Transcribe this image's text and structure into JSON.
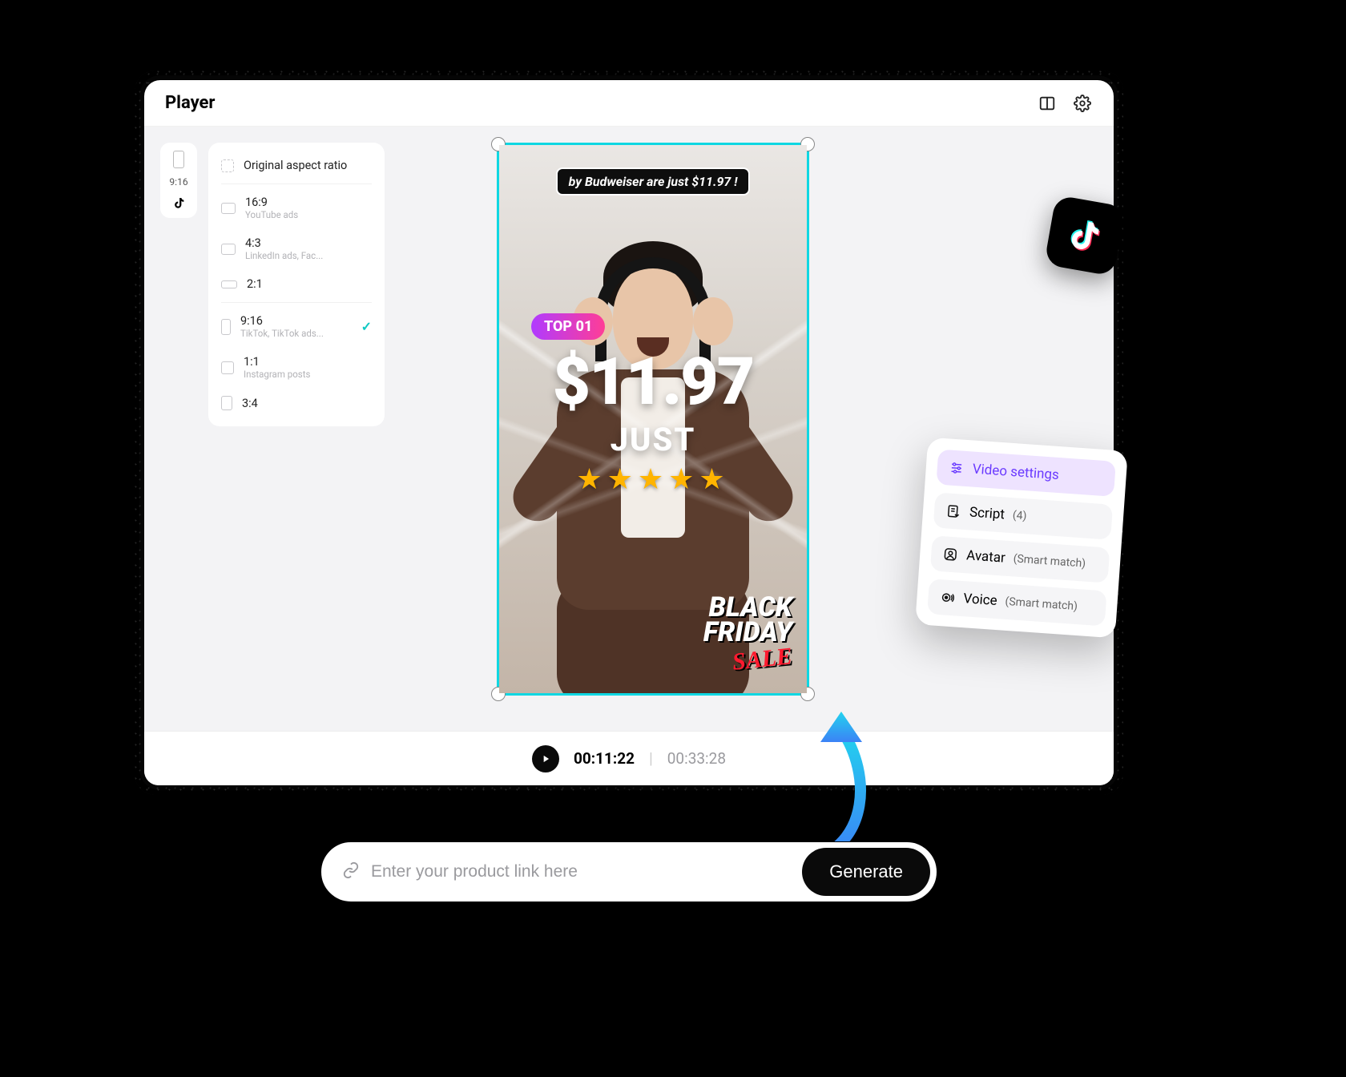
{
  "header": {
    "title": "Player"
  },
  "ratio_chip": {
    "label": "9:16"
  },
  "aspect": {
    "original": "Original aspect ratio",
    "items": [
      {
        "label": "16:9",
        "sub": "YouTube ads"
      },
      {
        "label": "4:3",
        "sub": "LinkedIn ads, Fac..."
      },
      {
        "label": "2:1",
        "sub": ""
      },
      {
        "label": "9:16",
        "sub": "TikTok, TikTok ads..."
      },
      {
        "label": "1:1",
        "sub": "Instagram posts"
      },
      {
        "label": "3:4",
        "sub": ""
      }
    ]
  },
  "video": {
    "caption": "by Budweiser are just $11.97 !",
    "top_badge": "TOP 01",
    "price": "$11.97",
    "just": "JUST",
    "stars": "★★★★★",
    "bf_line1": "BLACK",
    "bf_line2": "FRIDAY",
    "bf_sale": "SALE"
  },
  "play": {
    "current": "00:11:22",
    "total": "00:33:28"
  },
  "settings": {
    "video_settings": "Video settings",
    "script_label": "Script",
    "script_count": "(4)",
    "avatar_label": "Avatar",
    "avatar_hint": "(Smart match)",
    "voice_label": "Voice",
    "voice_hint": "(Smart match)"
  },
  "generate": {
    "placeholder": "Enter your product link here",
    "button": "Generate"
  }
}
